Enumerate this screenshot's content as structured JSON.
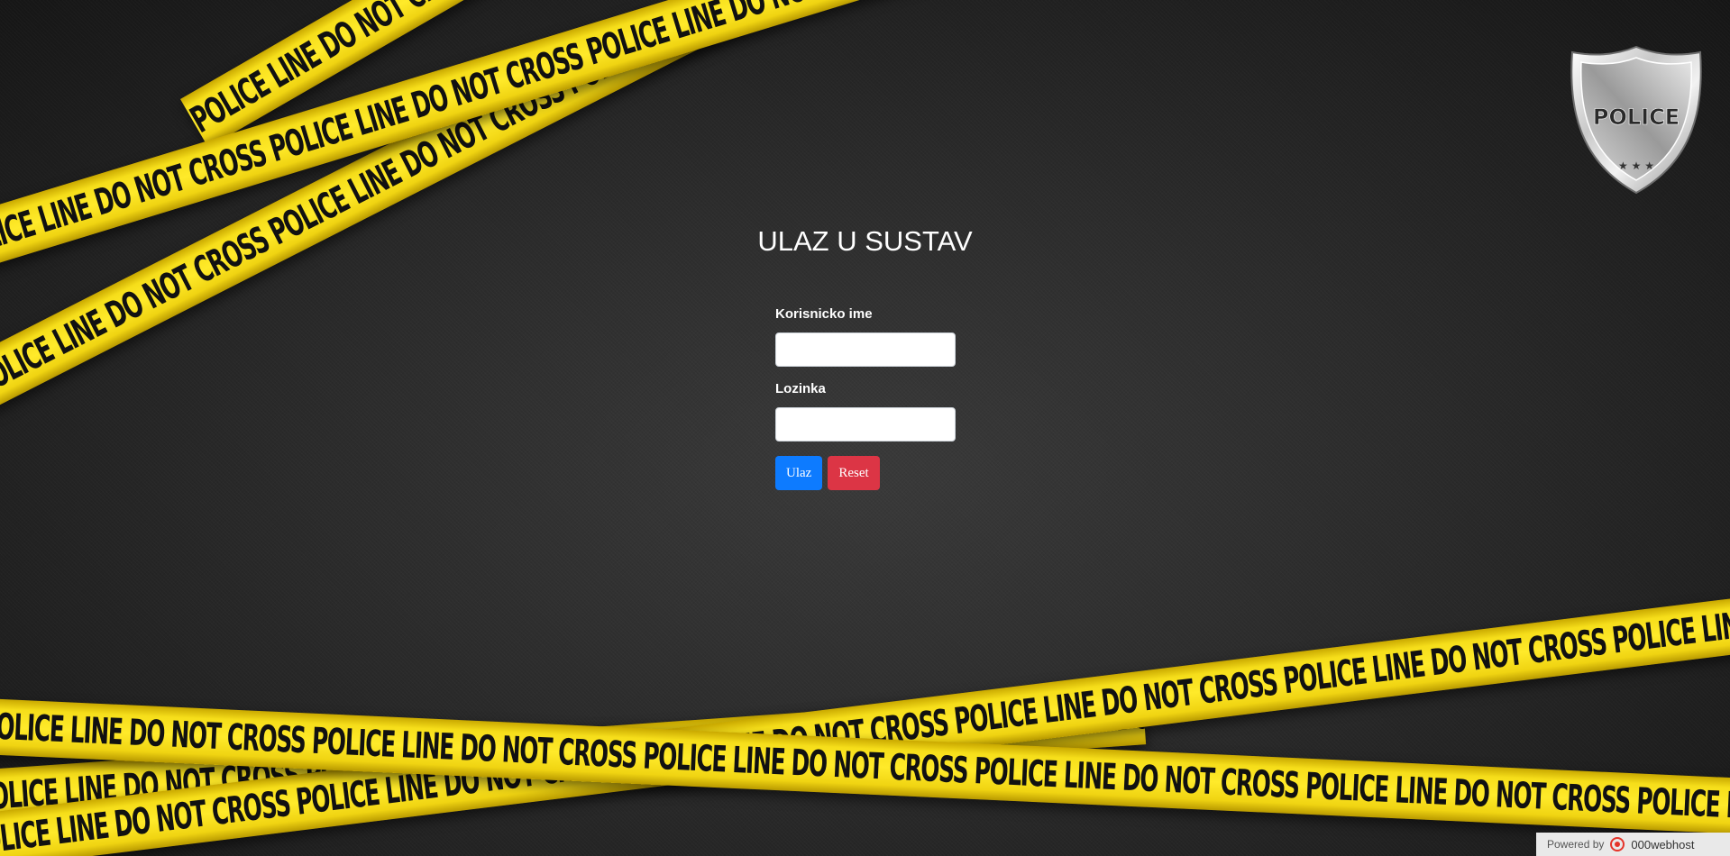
{
  "page": {
    "title": "ULAZ U SUSTAV"
  },
  "tape": {
    "text": "POLICE LINE DO NOT CROSS POLICE LINE DO NOT CROSS POLICE LINE DO NOT CROSS POLICE LINE DO NOT CROSS POLICE LINE DO NOT CROSS POLICE LINE DO NOT CROSS"
  },
  "badge": {
    "text": "POLICE",
    "icon": "police-shield-badge"
  },
  "form": {
    "username_label": "Korisnicko ime",
    "username_value": "",
    "password_label": "Lozinka",
    "password_value": "",
    "submit_label": "Ulaz",
    "reset_label": "Reset"
  },
  "footer": {
    "powered_label": "Powered by",
    "brand": "000webhost"
  },
  "colors": {
    "tape_yellow": "#ffea2a",
    "primary": "#0d7bff",
    "danger": "#dc3545"
  }
}
